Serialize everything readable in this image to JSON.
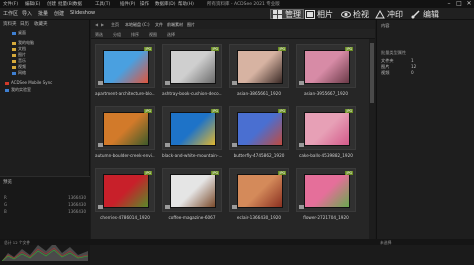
{
  "window": {
    "title": "所有资料库 - ACDSee 2021 专业版",
    "menus": [
      "文件(F)",
      "编辑(E)",
      "创建",
      "批量(B)",
      "数据",
      "工具(T)",
      "插件(P)",
      "操作",
      "数据库(D)",
      "帮助(H)"
    ]
  },
  "toolbar": {
    "left_items": [
      "工作区",
      "导入",
      "批量",
      "创建",
      "Slideshow"
    ],
    "modes": [
      {
        "label": "管理",
        "icon": "grid-icon",
        "active": true
      },
      {
        "label": "相片",
        "icon": "photo-icon",
        "active": false
      },
      {
        "label": "检视",
        "icon": "eye-icon",
        "active": false
      },
      {
        "label": "冲印",
        "icon": "develop-icon",
        "active": false
      },
      {
        "label": "编辑",
        "icon": "brush-icon",
        "active": false
      }
    ]
  },
  "left_panel": {
    "tabs": [
      "资料夹",
      "日历",
      "收藏夹"
    ],
    "tree": [
      {
        "label": "桌面",
        "icon": "blue"
      },
      {
        "label": "我的电脑",
        "icon": "folder"
      },
      {
        "label": "文档",
        "icon": "folder"
      },
      {
        "label": "图片",
        "icon": "folder"
      },
      {
        "label": "音乐",
        "icon": "folder"
      },
      {
        "label": "视频",
        "icon": "folder"
      },
      {
        "label": "网络",
        "icon": "blue"
      }
    ],
    "cloud_item": "ACDSee Mobile Sync",
    "cloud_item2": "我的实验室",
    "histogram": {
      "tab": "预览",
      "rows": [
        [
          "R",
          "1366430"
        ],
        [
          "G",
          "1366430"
        ],
        [
          "B",
          "1366430"
        ]
      ]
    }
  },
  "breadcrumbs": [
    "主页",
    "本地磁盘 (C:)",
    "文件",
    "前端素材",
    "图片"
  ],
  "filterbar": [
    "筛选",
    "分组",
    "排序",
    "视图",
    "选择"
  ],
  "thumbnails": [
    {
      "caption": "apartment-architecture-blo...",
      "badge": "JPG",
      "colors": [
        "#4aa0e0",
        "#e0553d"
      ]
    },
    {
      "caption": "ashtray-book-cushion-deco...",
      "badge": "JPG",
      "colors": [
        "#cfcfcf",
        "#6b6b6b"
      ]
    },
    {
      "caption": "asian-3865661_1920",
      "badge": "JPG",
      "colors": [
        "#d7b3a2",
        "#3b2a26"
      ]
    },
    {
      "caption": "asian-3955667_1920",
      "badge": "JPG",
      "colors": [
        "#d78ba6",
        "#6b3a48"
      ]
    },
    {
      "caption": "autumn-boulder-creek-envi...",
      "badge": "JPG",
      "colors": [
        "#d27a2a",
        "#3d5a2a"
      ]
    },
    {
      "caption": "black-and-white-mountain-...",
      "badge": "JPG",
      "colors": [
        "#1e73c8",
        "#e0b730"
      ]
    },
    {
      "caption": "butterfly-4745862_1920",
      "badge": "JPG",
      "colors": [
        "#4a6fd1",
        "#c04a40"
      ]
    },
    {
      "caption": "cake-balls-4539882_1920",
      "badge": "JPG",
      "colors": [
        "#e7a0b6",
        "#d35a8a"
      ]
    },
    {
      "caption": "cherries-4786014_1920",
      "badge": "JPG",
      "colors": [
        "#c8202a",
        "#5a8a2a"
      ]
    },
    {
      "caption": "coffee-magazine-6067",
      "badge": "JPG",
      "colors": [
        "#e5e5e5",
        "#7a4a2a"
      ]
    },
    {
      "caption": "eclair-1366430_1920",
      "badge": "JPG",
      "colors": [
        "#d48a5a",
        "#8a3020"
      ]
    },
    {
      "caption": "flower-2721704_1920",
      "badge": "JPG",
      "colors": [
        "#e56f9a",
        "#6aa84f"
      ]
    }
  ],
  "right_panel": {
    "tab": "内容",
    "section": "批量类型属性",
    "fields": [
      {
        "label": "文件夹",
        "value": "1"
      },
      {
        "label": "图片",
        "value": "12"
      },
      {
        "label": "视频",
        "value": "0"
      }
    ]
  },
  "status": {
    "left": "总计 12 个文件",
    "right": "未选择"
  }
}
